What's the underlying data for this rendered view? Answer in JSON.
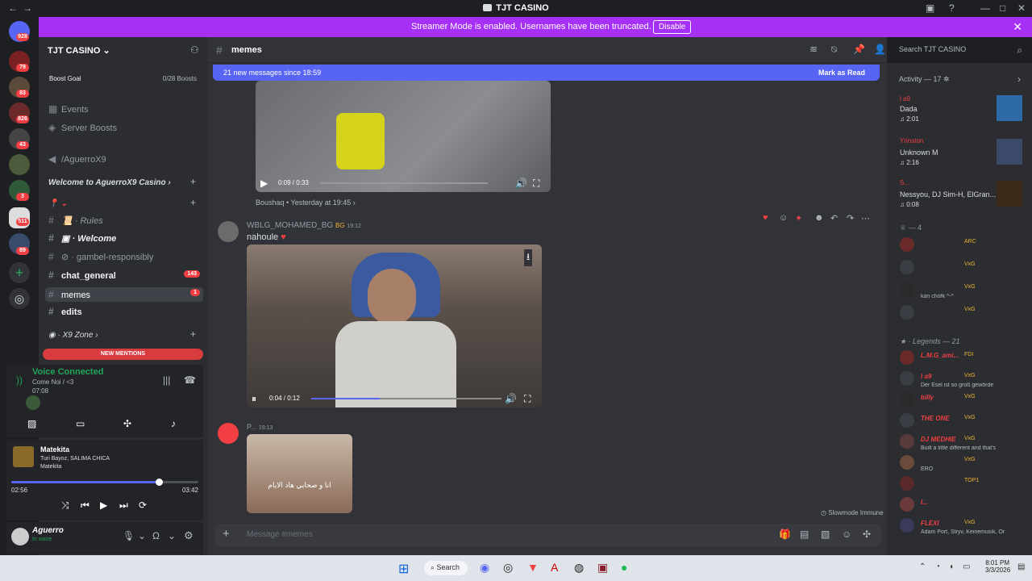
{
  "window": {
    "title": "TJT CASINO"
  },
  "banner": {
    "message": "Streamer Mode is enabled. Usernames have been truncated.",
    "disable_label": "Disable"
  },
  "guild_badges": [
    "928",
    "79",
    "83",
    "826",
    "43",
    "3",
    "511",
    "89"
  ],
  "server": {
    "name": "TJT CASINO",
    "boost_goal": "Boost Goal",
    "boost_count": "0/28 Boosts"
  },
  "nav": {
    "events": "Events",
    "server_boosts": "Server Boosts"
  },
  "channels": {
    "aguerro": "/AguerroX9",
    "welcome_cat": "Welcome to AguerroX9 Casino",
    "rules": "Rules",
    "welcome": "Welcome",
    "gambel": "gambel-responsibly",
    "chat_general": "chat_general",
    "chat_general_badge": "143",
    "memes": "memes",
    "memes_badge": "1",
    "edits": "edits",
    "x9zone": "X9 Zone",
    "new_mentions": "NEW MENTIONS"
  },
  "voice": {
    "status": "Voice Connected",
    "channel": "Come Noi / <3",
    "time": "07:08"
  },
  "player": {
    "title": "Matekita",
    "artist": "Turi Bayoz, SALIMA CHICA",
    "album": "Matekita",
    "elapsed": "02:56",
    "duration": "03:42",
    "progress": 0.79
  },
  "user": {
    "name": "Aguerro",
    "status": "In voice"
  },
  "header": {
    "channel": "memes",
    "search_placeholder": "Search TJT CASINO"
  },
  "new_messages": {
    "text": "21 new messages since 18:59",
    "mark_read": "Mark as Read"
  },
  "messages": [
    {
      "video_time": "0:09 / 0:33",
      "reply_user": "Boushaq",
      "reply_time": "Yesterday at 19:45"
    },
    {
      "author": "WBLG_MOHAMED_BG",
      "tag": "BG",
      "time": "19:12",
      "text": "nahoule",
      "video_time": "0:04 / 0:12"
    },
    {
      "author": "P...",
      "time": "19:13",
      "image_caption": "انا و صحابي هاد الايام"
    }
  ],
  "slowmode": "Slowmode Immune",
  "input_placeholder": "Message #memes",
  "activity": {
    "header": "Activity — 17",
    "items": [
      {
        "user": "l a9",
        "title": "Dada",
        "time": "2:01"
      },
      {
        "user": "Yrinston",
        "title": "Unknown M",
        "time": "2:16"
      },
      {
        "user": "S...",
        "title": "Nessyou, DJ Sim-H, ElGran...",
        "time": "0:08"
      }
    ]
  },
  "members": {
    "group1": "4",
    "group1_rows": [
      {
        "tag": "ARC",
        "status": ""
      },
      {
        "tag": "VxG",
        "status": ""
      },
      {
        "tag": "VxG",
        "status": "kan chofk ^-^"
      },
      {
        "tag": "VxG",
        "status": ""
      }
    ],
    "group2": "Legends — 21",
    "group2_rows": [
      {
        "name": "L.M.G_ami...",
        "tag": "FDI",
        "status": ""
      },
      {
        "name": "l a9",
        "tag": "VxG",
        "status": "Der Esel ist so groß gewörde"
      },
      {
        "name": "billy",
        "tag": "VxG",
        "status": ""
      },
      {
        "name": "THE ONE",
        "tag": "VxG",
        "status": ""
      },
      {
        "name": "DJ MEDHIE",
        "tag": "VxG",
        "status": "Built a little different and that's"
      },
      {
        "name": "",
        "tag": "VxG",
        "status": "ERO"
      },
      {
        "name": "",
        "tag": "TOP1",
        "status": ""
      },
      {
        "name": "I...",
        "tag": "",
        "status": ""
      },
      {
        "name": "FLEXI",
        "tag": "VxG",
        "status": "Adam Port, Stryv, Keinemusik, Or"
      }
    ]
  },
  "taskbar": {
    "search": "Search",
    "time": "8:01 PM",
    "date": "3/3/2026"
  }
}
